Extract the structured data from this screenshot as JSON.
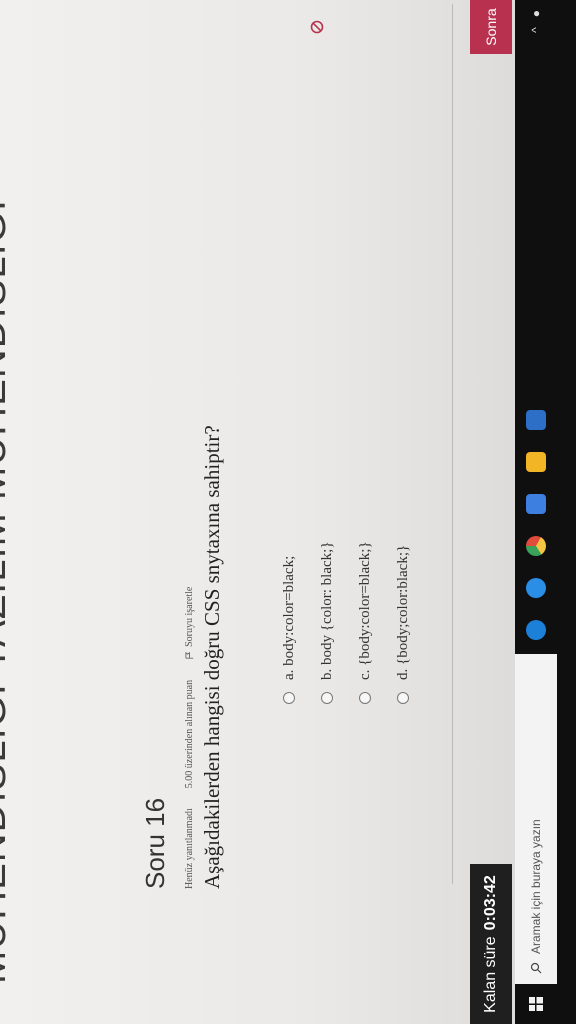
{
  "header": {
    "banner": "MÜHENDİSLİĞİ YAZILIM MÜHENDİSLİĞİ"
  },
  "question": {
    "number_title": "Soru 16",
    "status": "Henüz yanıtlanmadı",
    "points": "5.00 üzerinden alınan puan",
    "flag_label": "Soruyu işaretle",
    "text": "Aşağıdakilerden hangisi doğru CSS snytaxına sahiptir?",
    "options": [
      {
        "label": "a. body:color=black;"
      },
      {
        "label": "b. body {color: black;}"
      },
      {
        "label": "c. {body:color=black;}"
      },
      {
        "label": "d. {body;color:black;}"
      }
    ]
  },
  "timer": {
    "label": "Kalan süre",
    "value": "0:03:42"
  },
  "navigation": {
    "next_label": "Sonra"
  },
  "taskbar": {
    "search_placeholder": "Aramak için buraya yazın",
    "icons": [
      "start-icon",
      "search-icon",
      "edge-icon",
      "mail-icon",
      "chrome-icon",
      "store-icon",
      "photos-icon",
      "explorer-icon"
    ]
  },
  "colors": {
    "accent": "#b8324f",
    "stop": "#b8324f"
  }
}
